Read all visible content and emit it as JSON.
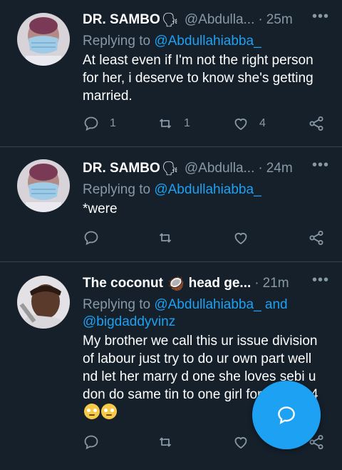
{
  "tweets": [
    {
      "name": "DR. SAMBO",
      "name_emoji": "🗣",
      "handle": "@Abdulla...",
      "dot": "·",
      "time": "25m",
      "replying_prefix": "Replying to ",
      "replying_to": "@Abdullahiabba_",
      "text": "At least even if I'm not the right person for her, i deserve to know she's getting married.",
      "reply_count": "1",
      "retweet_count": "1",
      "like_count": "4"
    },
    {
      "name": "DR. SAMBO",
      "name_emoji": "🗣",
      "handle": "@Abdulla...",
      "dot": "·",
      "time": "24m",
      "replying_prefix": "Replying to ",
      "replying_to": "@Abdullahiabba_",
      "text": "*were",
      "reply_count": "",
      "retweet_count": "",
      "like_count": ""
    },
    {
      "name": "The coconut",
      "name_emoji": "🥥",
      "name_suffix": "head ge...",
      "dot": "·",
      "time": "21m",
      "replying_prefix": "Replying to ",
      "replying_to": "@Abdullahiabba_ and @bigdaddyvinz",
      "text": "My brother we call this ur issue division of labour just try to do ur own part well nd let her marry d one she loves sebi u don do same tin to one girl for",
      "text_end": "street b4",
      "reply_count": "",
      "retweet_count": "",
      "like_count": ""
    }
  ],
  "more_symbol": "•••",
  "colors": {
    "background": "#15202b",
    "accent": "#1da1f2",
    "muted": "#8899a6",
    "divider": "#38444d"
  },
  "icons": [
    "reply-icon",
    "retweet-icon",
    "like-icon",
    "share-icon",
    "more-icon",
    "compose-icon"
  ]
}
